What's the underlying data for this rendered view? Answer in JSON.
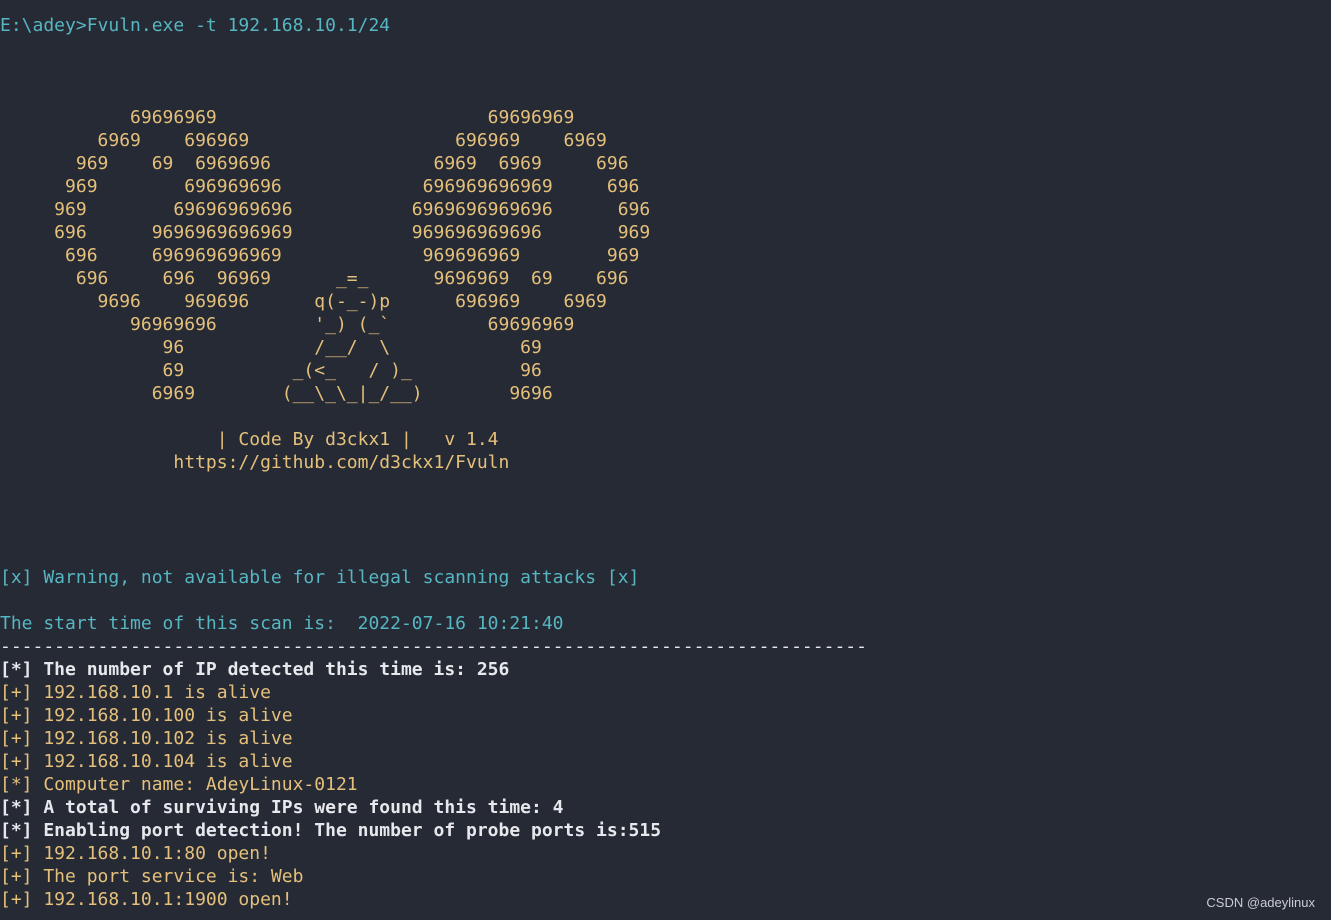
{
  "colors": {
    "background": "#262a35",
    "cyan": "#56b6c2",
    "yellow": "#e5c07b",
    "white": "#e6e8ec"
  },
  "command_line": "E:\\adey>Fvuln.exe -t 192.168.10.1/24",
  "banner": [
    "",
    "",
    "",
    "            69696969                         69696969",
    "         6969    696969                   696969    6969",
    "       969    69  6969696               6969  6969     696",
    "      969        696969696             696969696969     696",
    "     969        69696969696           6969696969696      696",
    "     696      9696969696969           969696969696       969",
    "      696     696969696969             969696969        969",
    "       696     696  96969      _=_      9696969  69    696",
    "         9696    969696      q(-_-)p      696969    6969",
    "            96969696         '_) (_`         69696969",
    "               96            /__/  \\            69",
    "               69          _(<_   / )_          96",
    "              6969        (__\\_\\_|_/__)        9696",
    "",
    "                    | Code By d3ckx1 |   v 1.4",
    "                https://github.com/d3ckx1/Fvuln",
    "",
    "",
    "",
    ""
  ],
  "warning": "[x] Warning, not available for illegal scanning attacks [x]",
  "start_time": "The start time of this scan is:  2022-07-16 10:21:40",
  "separator": "--------------------------------------------------------------------------------",
  "output": [
    {
      "text": "[*] The number of IP detected this time is: 256",
      "style": "white"
    },
    {
      "text": "[+] 192.168.10.1 is alive",
      "style": "yellow"
    },
    {
      "text": "[+] 192.168.10.100 is alive",
      "style": "yellow"
    },
    {
      "text": "[+] 192.168.10.102 is alive",
      "style": "yellow"
    },
    {
      "text": "[+] 192.168.10.104 is alive",
      "style": "yellow"
    },
    {
      "text": "[*] Computer name: AdeyLinux-0121",
      "style": "yellow"
    },
    {
      "text": "[*] A total of surviving IPs were found this time: 4",
      "style": "white"
    },
    {
      "text": "[*] Enabling port detection! The number of probe ports is:515",
      "style": "white"
    },
    {
      "text": "[+] 192.168.10.1:80 open!",
      "style": "yellow"
    },
    {
      "text": "[+] The port service is: Web",
      "style": "yellow"
    },
    {
      "text": "[+] 192.168.10.1:1900 open!",
      "style": "yellow"
    }
  ],
  "watermark": "CSDN @adeylinux"
}
